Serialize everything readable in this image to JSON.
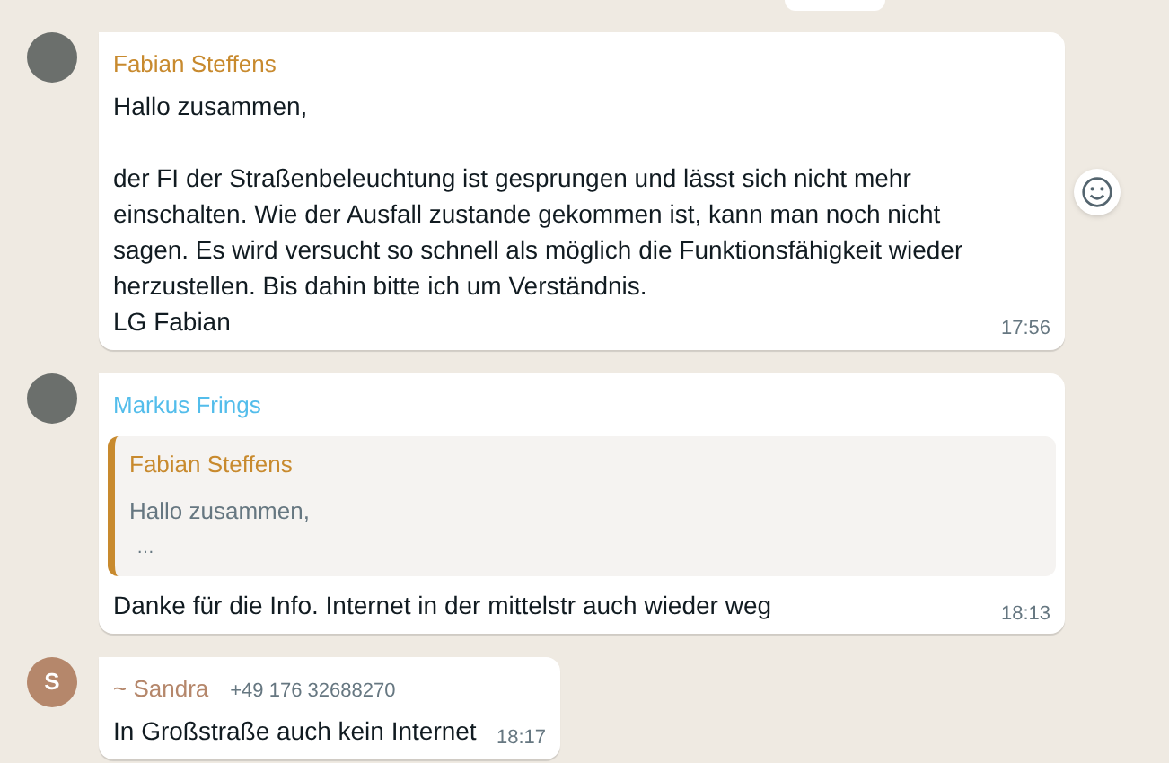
{
  "messages": [
    {
      "sender": "Fabian Steffens",
      "color": "#c88a2e",
      "avatar": {
        "kind": "photo"
      },
      "text": "Hallo zusammen,\n\nder FI der Straßenbeleuchtung ist gesprungen und lässt sich nicht mehr einschalten. Wie der Ausfall zustande gekommen ist, kann man noch nicht sagen. Es wird versucht so schnell als möglich die Funktionsfähigkeit wieder herzustellen. Bis dahin bitte ich um Verständnis.\nLG Fabian",
      "time": "17:56",
      "reaction_button": true
    },
    {
      "sender": "Markus Frings",
      "color": "#53bdeb",
      "avatar": {
        "kind": "photo"
      },
      "quote": {
        "sender": "Fabian Steffens",
        "color": "#c88a2e",
        "lines": [
          "Hallo zusammen,",
          "…"
        ]
      },
      "text": "Danke für die Info. Internet in der mittelstr auch wieder weg",
      "time": "18:13",
      "reaction_button": false
    },
    {
      "sender": "~ Sandra",
      "color": "#b5876b",
      "phone": "+49 176 32688270",
      "avatar": {
        "kind": "initial",
        "letter": "S",
        "color": "#b5876b"
      },
      "text": "In Großstraße auch kein Internet",
      "time": "18:17",
      "reaction_button": false
    }
  ]
}
